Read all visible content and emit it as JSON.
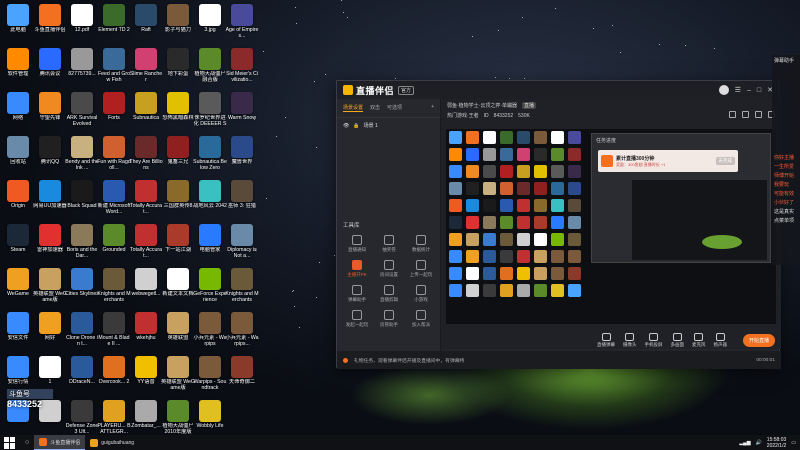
{
  "desktop": {
    "icons": [
      {
        "label": "此电脑",
        "color": "#4aa3ff"
      },
      {
        "label": "斗鱼直播伴侣",
        "color": "#f37021"
      },
      {
        "label": "12.pdf",
        "color": "#ffffff"
      },
      {
        "label": "Element TD 2",
        "color": "#3b6b2a"
      },
      {
        "label": "Raft",
        "color": "#2a4a6a"
      },
      {
        "label": "影子与猫刀",
        "color": "#7a5a3a"
      },
      {
        "label": "3.jpg",
        "color": "#ffffff"
      },
      {
        "label": "Age of Empires...",
        "color": "#4a4a9a"
      },
      {
        "label": "软件管理",
        "color": "#ff8a00"
      },
      {
        "label": "腾讯会议",
        "color": "#2a6aff"
      },
      {
        "label": "82775739...",
        "color": "#999999"
      },
      {
        "label": "Feed and Grow Fish",
        "color": "#3a6a9a"
      },
      {
        "label": "Slime Rancher",
        "color": "#d04070"
      },
      {
        "label": "地下彩蛋",
        "color": "#2a2a2a"
      },
      {
        "label": "植物大战僵尸融合版",
        "color": "#5a8a2a"
      },
      {
        "label": "Sid Meier's Civilizatio...",
        "color": "#8a2a2a"
      },
      {
        "label": "网络",
        "color": "#3a8aff"
      },
      {
        "label": "守望先锋",
        "color": "#f08a20"
      },
      {
        "label": "ARK Survival Evolved",
        "color": "#4a4a4a"
      },
      {
        "label": "Forts",
        "color": "#b02020"
      },
      {
        "label": "Subnautica",
        "color": "#c8a020"
      },
      {
        "label": "恐怖黑暗森林",
        "color": "#e0c000"
      },
      {
        "label": "侏罗纪世界进化 DEEEER SIMULATOR",
        "color": "#5a5a5a"
      },
      {
        "label": "Warm Snow",
        "color": "#3a2a4a"
      },
      {
        "label": "回收站",
        "color": "#6a8aaa"
      },
      {
        "label": "腾讯QQ",
        "color": "#202020"
      },
      {
        "label": "Bendy and the Ink ...",
        "color": "#c8b080"
      },
      {
        "label": "Fun with Ragdoll...",
        "color": "#d06030"
      },
      {
        "label": "They Are Billions",
        "color": "#6a2a2a"
      },
      {
        "label": "鬼畜三兄",
        "color": "#902020"
      },
      {
        "label": "Subnautica Below Zero",
        "color": "#2a6a9a"
      },
      {
        "label": "魔兽世界",
        "color": "#2a4a8a"
      },
      {
        "label": "Origin",
        "color": "#f05a22"
      },
      {
        "label": "网易UU加速器",
        "color": "#1a8adf"
      },
      {
        "label": "Black Squad",
        "color": "#1a1a1a"
      },
      {
        "label": "新建 Microsoft Word...",
        "color": "#2a5aaf"
      },
      {
        "label": "Totally Accurat...",
        "color": "#c03030"
      },
      {
        "label": "三国群英传8",
        "color": "#8a6a2a"
      },
      {
        "label": "战地风云 2042",
        "color": "#3ac0c0"
      },
      {
        "label": "巫师 3: 狂猎",
        "color": "#5a4a3a"
      },
      {
        "label": "Steam",
        "color": "#1b2838"
      },
      {
        "label": "雷神加速器",
        "color": "#e03030"
      },
      {
        "label": "Boris and the Dar...",
        "color": "#8a7a5a"
      },
      {
        "label": "Grounded",
        "color": "#5a8a2a"
      },
      {
        "label": "Totally Accurat...",
        "color": "#c03030"
      },
      {
        "label": "下一站江湖",
        "color": "#aa3a2a"
      },
      {
        "label": "电脑管家",
        "color": "#2a7aff"
      },
      {
        "label": "Diplomacy is Not a...",
        "color": "#6a8aaa"
      },
      {
        "label": "WeGame",
        "color": "#f0a020"
      },
      {
        "label": "英雄联盟 WeGame版",
        "color": "#c8a060"
      },
      {
        "label": "Cities Skylines",
        "color": "#3a7acf"
      },
      {
        "label": "Knights and Merchants",
        "color": "#6a5a3a"
      },
      {
        "label": "webwegetl...",
        "color": "#d0d0d0"
      },
      {
        "label": "新建文本文档",
        "color": "#ffffff"
      },
      {
        "label": "GeForce Experience",
        "color": "#76b900"
      },
      {
        "label": "Knights and Merchants",
        "color": "#6a5a3a"
      },
      {
        "label": "安信文件",
        "color": "#3a8aff"
      },
      {
        "label": "网好",
        "color": "#f0a020"
      },
      {
        "label": "Clone Drone in t...",
        "color": "#2a5a9a"
      },
      {
        "label": "Mount & Blade II ...",
        "color": "#3a3a3a"
      },
      {
        "label": "wkehjhu",
        "color": "#c03030"
      },
      {
        "label": "英雄联盟",
        "color": "#c8a060"
      },
      {
        "label": "小兵元素 - Warpips",
        "color": "#7a5a3a"
      },
      {
        "label": "小兵元素 - Warpips...",
        "color": "#7a5a3a"
      },
      {
        "label": "安信行情",
        "color": "#3a8aff"
      },
      {
        "label": "1",
        "color": "#ffffff"
      },
      {
        "label": "DDraceN...",
        "color": "#2a5a9a"
      },
      {
        "label": "Overcook... 2",
        "color": "#e07020"
      },
      {
        "label": "YY语音",
        "color": "#f0c000"
      },
      {
        "label": "英雄联盟 WeGame版",
        "color": "#c8a060"
      },
      {
        "label": "Warpips - Soundtrack",
        "color": "#7a5a3a"
      },
      {
        "label": "天命奇御二",
        "color": "#8a3a2a"
      },
      {
        "label": "",
        "color": "#3a8aff"
      },
      {
        "label": "",
        "color": "#d0d0d0"
      },
      {
        "label": "Defense Zone 3 Ult...",
        "color": "#3a3a3a"
      },
      {
        "label": "PLAYERU... BATTLEGR...",
        "color": "#e0a020"
      },
      {
        "label": "Zombatar_...",
        "color": "#aaaaaa"
      },
      {
        "label": "植物大战僵尸 2010年度版",
        "color": "#5a8a2a"
      },
      {
        "label": "Wobbly Life",
        "color": "#e0c020"
      }
    ]
  },
  "app": {
    "name": "直播伴侣",
    "badge": "官方",
    "left_tabs": [
      "场景设置",
      "双击",
      "可选项"
    ],
    "scene_label": "场景 1",
    "tools_title": "工具库",
    "tools": [
      {
        "label": "直播通知",
        "hot": false
      },
      {
        "label": "抽奖卷",
        "hot": false
      },
      {
        "label": "数据统计",
        "hot": false
      },
      {
        "label": "主播开PK",
        "hot": true
      },
      {
        "label": "房间设置",
        "hot": false
      },
      {
        "label": "上传一起玩",
        "hot": false
      },
      {
        "label": "弹幕助手",
        "hot": false
      },
      {
        "label": "直播剪辑",
        "hot": false
      },
      {
        "label": "小游戏",
        "hot": false
      },
      {
        "label": "发起一起玩",
        "hot": false
      },
      {
        "label": "房管助手",
        "hot": false
      },
      {
        "label": "加入帮派",
        "hot": false
      }
    ],
    "stream_title": "弱鱼·植物学士·云顶之弈·单蹦器",
    "stream_tag": "直播",
    "stream_info": [
      "热门游戏·王者",
      "ID",
      "8433252",
      "530K"
    ],
    "nested_title": "任务进度",
    "notice_main": "累计直播300分钟",
    "notice_sub": "奖励：300鱼翅 直播时长 +1",
    "notice_btn": "去完成",
    "bottom_tools": [
      "直播弹幕",
      "摄像头",
      "手机投屏",
      "多画面",
      "麦克风",
      "扬声器"
    ],
    "start_button": "开始直播",
    "status_text": "礼物任务、观看弹幕伴侣开播及直播间中，有弹幕特",
    "status_time": "00:00:01"
  },
  "side_chat": {
    "lines": [
      {
        "text": "弹幕助手",
        "color": "#dddddd"
      },
      {
        "text": "你好主播",
        "color": "#ff5a3a"
      },
      {
        "text": "一生所爱",
        "color": "#ff5a3a"
      },
      {
        "text": "师傅开始",
        "color": "#ff5a3a"
      },
      {
        "text": "我要玩",
        "color": "#ff5a3a"
      },
      {
        "text": "可能有效",
        "color": "#ff5a3a"
      },
      {
        "text": "小伙好了",
        "color": "#ff5a3a"
      },
      {
        "text": "这是真实",
        "color": "#dddddd"
      },
      {
        "text": "点菜单项",
        "color": "#dddddd"
      }
    ]
  },
  "overlay": {
    "label": "斗鱼号",
    "room_id": "8433252"
  },
  "taskbar": {
    "items": [
      {
        "label": "斗鱼直播伴侣",
        "active": true,
        "color": "#f37021"
      },
      {
        "label": "guigubaihuang",
        "active": false,
        "color": "#f0a020"
      }
    ],
    "clock_time": "15:58:03",
    "clock_date": "2022/1/2"
  }
}
